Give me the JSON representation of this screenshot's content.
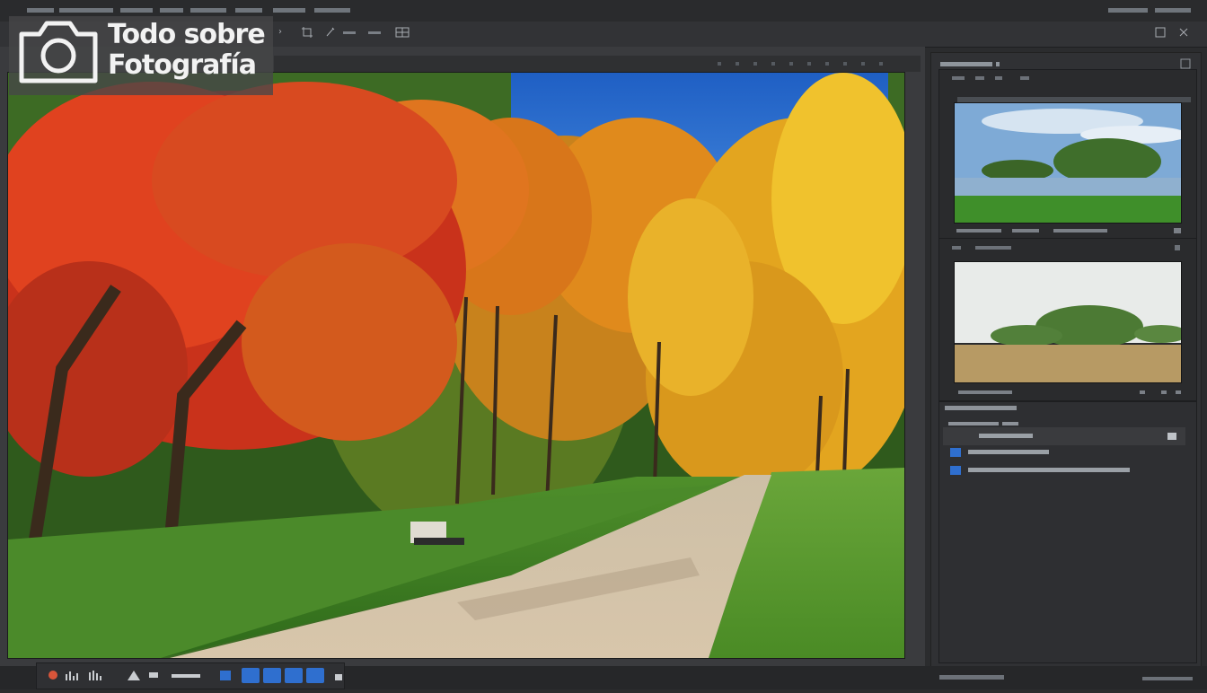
{
  "watermark": {
    "line1": "Todo sobre",
    "line2": "Fotografía"
  },
  "icons": [
    "camera-icon",
    "histogram-icon",
    "expand-icon",
    "close-icon",
    "lock-icon",
    "eye-icon"
  ],
  "colors": {
    "accent": "#3a8ee6",
    "panel": "#303134",
    "canvas_sky": "#1f63c6",
    "canvas_red": "#d33a1e",
    "canvas_yellow": "#e9b52a"
  }
}
